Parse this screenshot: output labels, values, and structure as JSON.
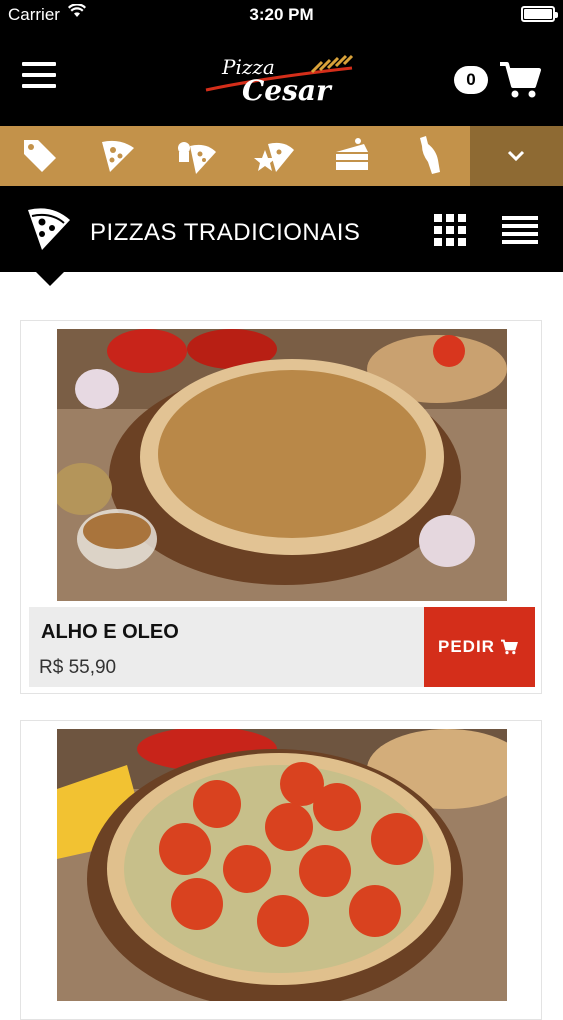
{
  "status_bar": {
    "carrier": "Carrier",
    "time": "3:20 PM"
  },
  "header": {
    "logo_text": "Pizza Cesar",
    "cart_count": "0",
    "menu_icon": "hamburger-menu-icon",
    "cart_icon": "shopping-cart-icon"
  },
  "categories": [
    {
      "icon": "tag-icon"
    },
    {
      "icon": "pizza-slice-icon"
    },
    {
      "icon": "chef-pizza-icon"
    },
    {
      "icon": "star-pizza-icon"
    },
    {
      "icon": "cake-slice-icon"
    },
    {
      "icon": "bottle-icon"
    }
  ],
  "section": {
    "title": "PIZZAS TRADICIONAIS",
    "icon": "pizza-slice-icon",
    "grid_view_icon": "grid-view-icon",
    "list_view_icon": "list-view-icon"
  },
  "products": [
    {
      "name": "ALHO E OLEO",
      "price": "R$ 55,90",
      "order_label": "PEDIR"
    },
    {
      "name": "",
      "price": "",
      "order_label": ""
    }
  ],
  "colors": {
    "header_bg": "#000000",
    "category_bar": "#c3924a",
    "category_toggle": "#8e6a33",
    "order_button": "#d42e1a",
    "card_info_bg": "#ececec"
  }
}
